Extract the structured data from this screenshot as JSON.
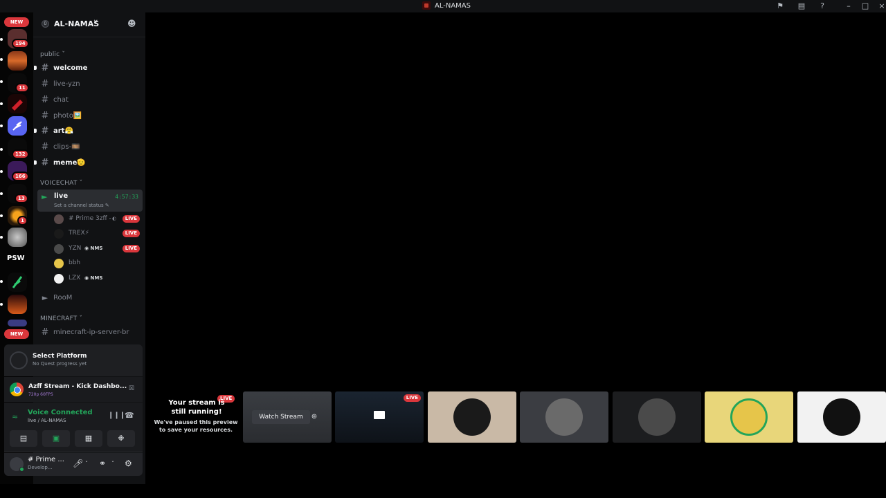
{
  "window": {
    "title": "AL-NAMAS"
  },
  "rail": {
    "new_label": "NEW",
    "badges": [
      "194",
      "11",
      "132",
      "166",
      "13",
      "1"
    ],
    "psw_label": "PSW",
    "new_bottom_label": "NEW"
  },
  "guild": {
    "boost_count": "0",
    "name": "AL-NAMAS",
    "chevron": "∨"
  },
  "categories": {
    "public": "public",
    "voicechat": "VOICECHAT",
    "minecraft": "MINECRAFT"
  },
  "channels": [
    {
      "name": "welcome",
      "unread": true
    },
    {
      "name": "live-yzn",
      "unread": false
    },
    {
      "name": "chat",
      "unread": false
    },
    {
      "name": "photo🖼️",
      "unread": false
    },
    {
      "name": "art😤",
      "unread": true
    },
    {
      "name": "clips-🎞️",
      "unread": false
    },
    {
      "name": "meme🫡",
      "unread": true
    }
  ],
  "voice_channel": {
    "name": "live",
    "time": "4:57:33",
    "status_prompt": "Set a channel status"
  },
  "voice_users": [
    {
      "name": "# Prime 3zff -",
      "tag": "",
      "live": "LIVE"
    },
    {
      "name": "TREX⚡",
      "tag": "",
      "live": "LIVE"
    },
    {
      "name": "YZN",
      "tag": "NMS",
      "live": "LIVE"
    },
    {
      "name": "bbh",
      "tag": "",
      "live": ""
    },
    {
      "name": "LZX",
      "tag": "NMS",
      "live": ""
    }
  ],
  "room_channel": "RooM",
  "minecraft_channel": "minecraft-ip-server-br",
  "quest": {
    "title": "Select Platform",
    "subtitle": "No Quest progress yet"
  },
  "activity": {
    "title": "Azff Stream - Kick Dashbo...",
    "subtitle": "720p 60FPS"
  },
  "voice": {
    "title": "Voice Connected",
    "subtitle": "live / AL-NAMAS"
  },
  "user": {
    "name": "# Prime ...",
    "status": "Develop..."
  },
  "stream": {
    "title": "Your stream is still running!",
    "description": "We've paused this preview to save your resources.",
    "live_label": "LIVE"
  },
  "tiles": {
    "watch_label": "Watch Stream",
    "live_label": "LIVE"
  },
  "colors": {
    "accent_green": "#23a55a",
    "live_red": "#da373c",
    "bg": "#111214"
  }
}
